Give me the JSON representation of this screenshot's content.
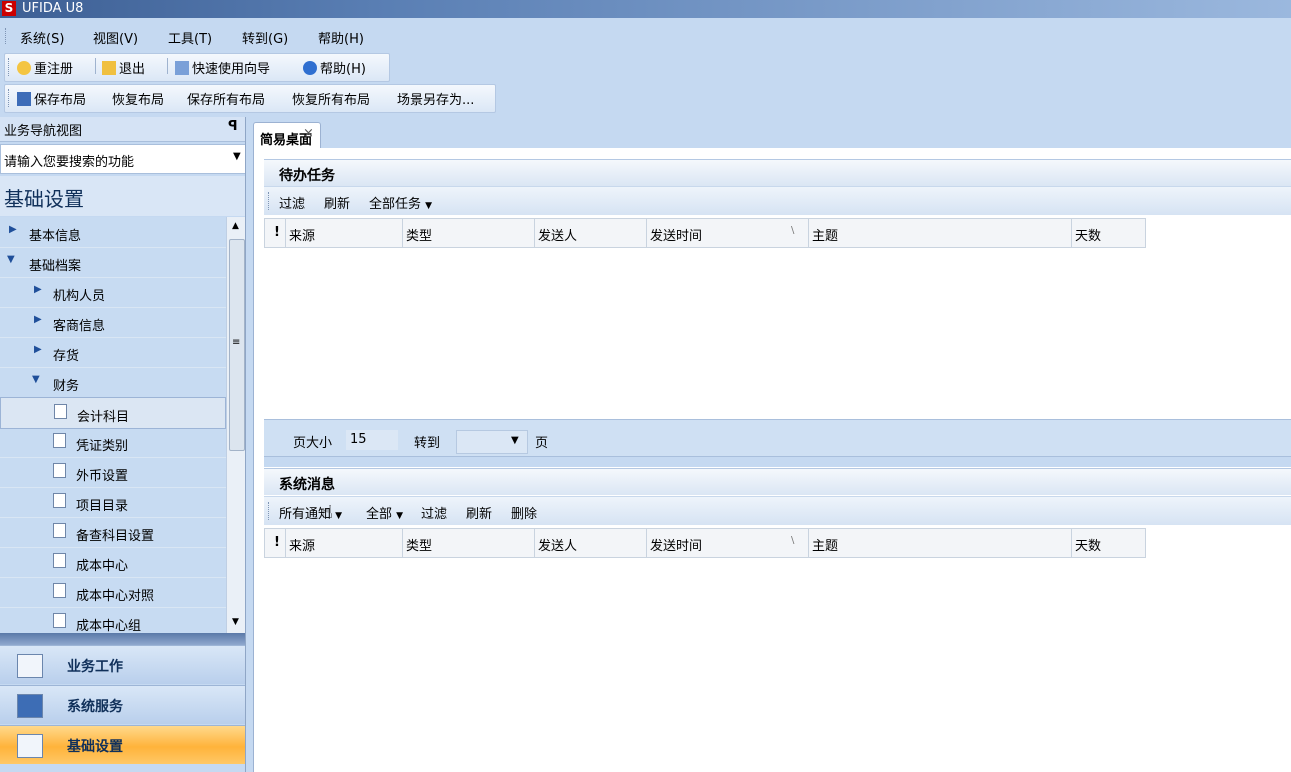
{
  "window": {
    "title": "UFIDA U8",
    "logo_text": "S"
  },
  "menubar": {
    "items": [
      "系统(S)",
      "视图(V)",
      "工具(T)",
      "转到(G)",
      "帮助(H)"
    ]
  },
  "toolbar1": {
    "items": [
      "重注册",
      "退出",
      "快速使用向导",
      "帮助(H)"
    ]
  },
  "toolbar2": {
    "items": [
      "保存布局",
      "恢复布局",
      "保存所有布局",
      "恢复所有布局",
      "场景另存为..."
    ]
  },
  "nav": {
    "header": "业务导航视图",
    "pin": "ṗ",
    "search_placeholder": "请输入您要搜索的功能",
    "title": "基础设置",
    "tree": [
      {
        "label": "基本信息",
        "level": 0,
        "expanded": false
      },
      {
        "label": "基础档案",
        "level": 0,
        "expanded": true
      },
      {
        "label": "机构人员",
        "level": 1,
        "expanded": false
      },
      {
        "label": "客商信息",
        "level": 1,
        "expanded": false
      },
      {
        "label": "存货",
        "level": 1,
        "expanded": false
      },
      {
        "label": "财务",
        "level": 1,
        "expanded": true
      },
      {
        "label": "会计科目",
        "level": 2,
        "selected": true
      },
      {
        "label": "凭证类别",
        "level": 2
      },
      {
        "label": "外币设置",
        "level": 2
      },
      {
        "label": "项目目录",
        "level": 2
      },
      {
        "label": "备查科目设置",
        "level": 2
      },
      {
        "label": "成本中心",
        "level": 2
      },
      {
        "label": "成本中心对照",
        "level": 2
      },
      {
        "label": "成本中心组",
        "level": 2
      }
    ],
    "bottom_buttons": [
      "业务工作",
      "系统服务",
      "基础设置"
    ]
  },
  "tabs": [
    {
      "label": "简易桌面",
      "close": "×"
    }
  ],
  "todo": {
    "title": "待办任务",
    "toolbar": [
      "过滤",
      "刷新",
      "全部任务"
    ],
    "columns": [
      "!",
      "来源",
      "类型",
      "发送人",
      "发送时间",
      "主题",
      "天数"
    ],
    "pager": {
      "page_size_label": "页大小",
      "page_size": "15",
      "goto_label": "转到",
      "page_label": "页"
    }
  },
  "messages": {
    "title": "系统消息",
    "toolbar": [
      "所有通知",
      "全部",
      "过滤",
      "刷新",
      "删除"
    ],
    "columns": [
      "!",
      "来源",
      "类型",
      "发送人",
      "发送时间",
      "主题",
      "天数"
    ]
  }
}
